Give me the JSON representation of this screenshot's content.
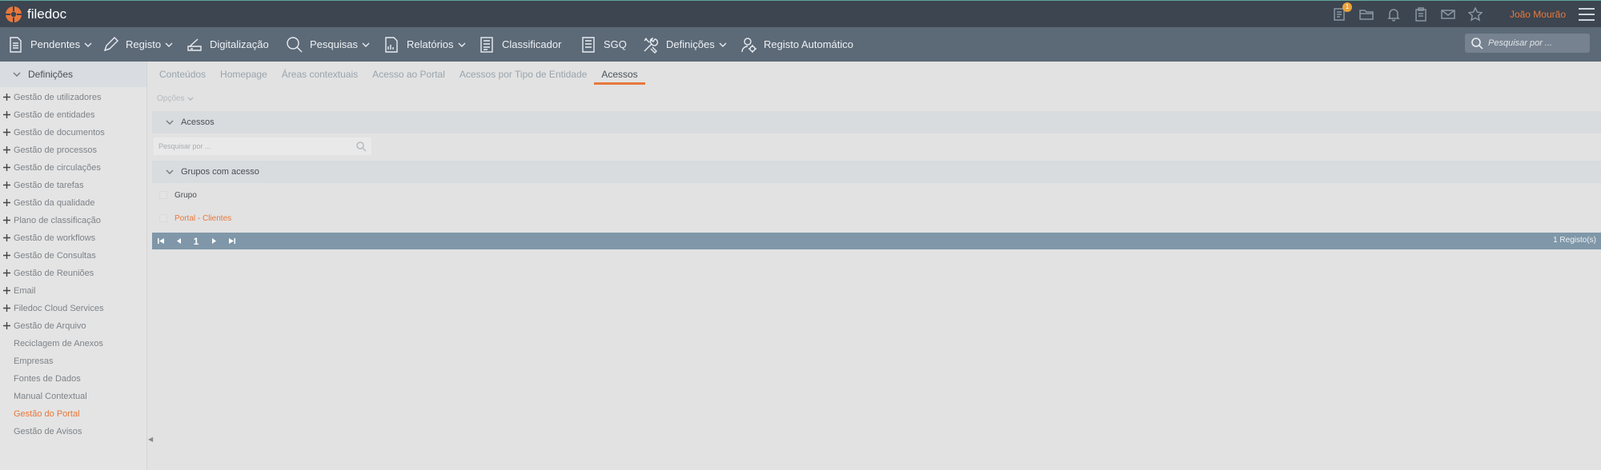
{
  "app": {
    "name": "filedoc",
    "user": "João Mourão",
    "badge_count": "1"
  },
  "top_icons": [
    "documents-icon",
    "folder-icon",
    "bell-icon",
    "clipboard-icon",
    "mail-icon",
    "star-icon"
  ],
  "nav": {
    "items": [
      {
        "label": "Pendentes",
        "icon": "document-icon",
        "dropdown": true
      },
      {
        "label": "Registo",
        "icon": "pen-icon",
        "dropdown": true
      },
      {
        "label": "Digitalização",
        "icon": "scanner-icon",
        "dropdown": false
      },
      {
        "label": "Pesquisas",
        "icon": "search-icon",
        "dropdown": true
      },
      {
        "label": "Relatórios",
        "icon": "report-icon",
        "dropdown": true
      },
      {
        "label": "Classificador",
        "icon": "classifier-icon",
        "dropdown": false
      },
      {
        "label": "SGQ",
        "icon": "sgq-icon",
        "dropdown": false
      },
      {
        "label": "Definições",
        "icon": "tools-icon",
        "dropdown": true
      },
      {
        "label": "Registo Automático",
        "icon": "user-gear-icon",
        "dropdown": false
      }
    ],
    "search_placeholder": "Pesquisar por ..."
  },
  "sidebar": {
    "header": "Definições",
    "items": [
      {
        "label": "Gestão de utilizadores",
        "expandable": true
      },
      {
        "label": "Gestão de entidades",
        "expandable": true
      },
      {
        "label": "Gestão de documentos",
        "expandable": true
      },
      {
        "label": "Gestão de processos",
        "expandable": true
      },
      {
        "label": "Gestão de circulações",
        "expandable": true
      },
      {
        "label": "Gestão de tarefas",
        "expandable": true
      },
      {
        "label": "Gestão da qualidade",
        "expandable": true
      },
      {
        "label": "Plano de classificação",
        "expandable": true
      },
      {
        "label": "Gestão de workflows",
        "expandable": true
      },
      {
        "label": "Gestão de Consultas",
        "expandable": true
      },
      {
        "label": "Gestão de Reuniões",
        "expandable": true
      },
      {
        "label": "Email",
        "expandable": true
      },
      {
        "label": "Filedoc Cloud Services",
        "expandable": true
      },
      {
        "label": "Gestão de Arquivo",
        "expandable": true
      },
      {
        "label": "Reciclagem de Anexos",
        "expandable": false
      },
      {
        "label": "Empresas",
        "expandable": false
      },
      {
        "label": "Fontes de Dados",
        "expandable": false
      },
      {
        "label": "Manual Contextual",
        "expandable": false
      },
      {
        "label": "Gestão do Portal",
        "expandable": false,
        "active": true
      },
      {
        "label": "Gestão de Avisos",
        "expandable": false
      }
    ]
  },
  "tabs": [
    "Conteúdos",
    "Homepage",
    "Áreas contextuais",
    "Acesso ao Portal",
    "Acessos por Tipo de Entidade",
    "Acessos"
  ],
  "active_tab": "Acessos",
  "main": {
    "options_label": "Opções",
    "section1_title": "Acessos",
    "search_placeholder": "Pesquisar por ...",
    "section2_title": "Grupos com acesso",
    "grid": {
      "column": "Grupo",
      "rows": [
        "Portal - Clientes"
      ]
    },
    "pager": {
      "page": "1",
      "count": "1 Registo(s)"
    }
  },
  "colors": {
    "accent": "#e8773c",
    "topbar": "#3c4550",
    "navbar": "#5c6977",
    "pager": "#7f97a8"
  }
}
